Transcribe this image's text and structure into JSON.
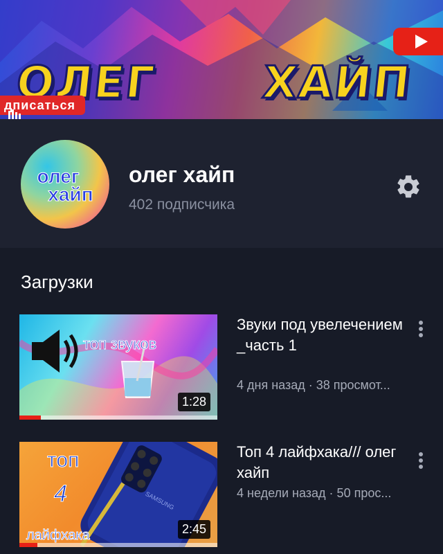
{
  "banner": {
    "title_left": "ОЛЕГ",
    "title_right": "ХАЙП",
    "subscribe_badge": "дписаться"
  },
  "channel": {
    "avatar_line1": "олег",
    "avatar_line2": "хайп",
    "name": "олег хайп",
    "subscribers": "402 подписчика"
  },
  "uploads": {
    "title": "Загрузки",
    "videos": [
      {
        "title": "Звуки под увелечением _часть 1",
        "meta": "4 дня назад · 38 просмот...",
        "duration": "1:28",
        "thumb_text": "топ звуков",
        "watched_fraction": 0.11
      },
      {
        "title": "Топ 4 лайфхака/// олег хайп",
        "meta": "4 недели назад · 50 прос...",
        "duration": "2:45",
        "thumb_text_top": "топ",
        "thumb_text_mid": "4",
        "thumb_text_bottom": "лайфхака",
        "phone_brand": "SAMSUNG",
        "watched_fraction": 0.09
      }
    ]
  },
  "colors": {
    "background": "#1e2230",
    "section_background": "#171b27",
    "accent_red": "#e62117",
    "muted_text": "#8a90a0"
  }
}
